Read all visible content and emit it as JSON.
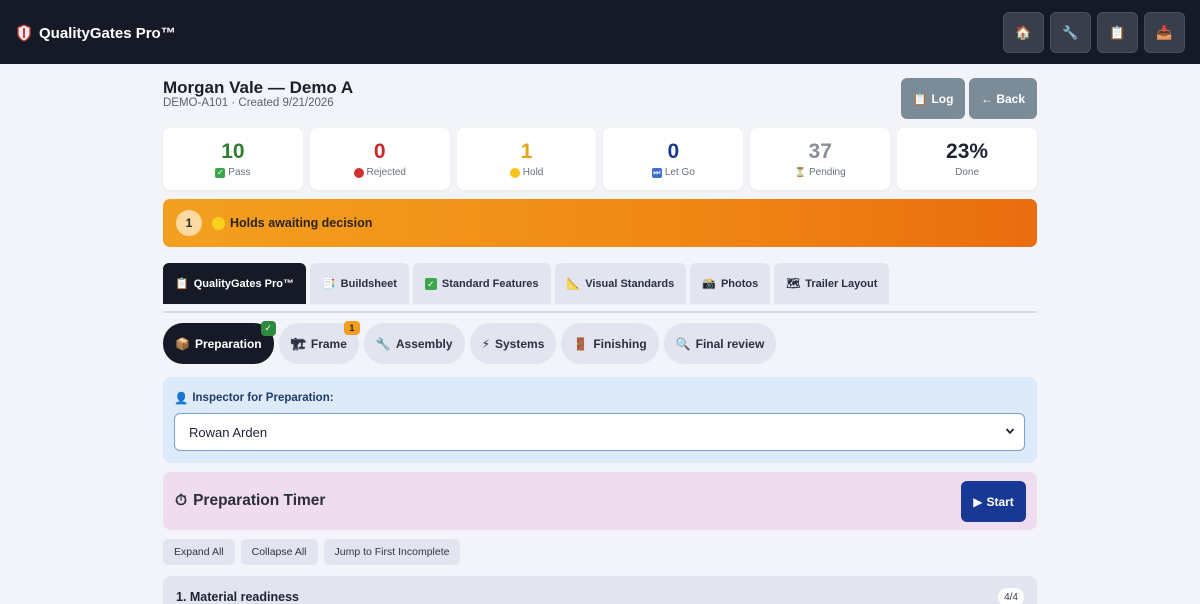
{
  "app": {
    "brand": "QualityGates Pro™",
    "nav": [
      {
        "icon": "home-icon",
        "glyph": "🏠"
      },
      {
        "icon": "wrench-icon",
        "glyph": "🔧"
      },
      {
        "icon": "clipboard-icon",
        "glyph": "📋"
      },
      {
        "icon": "inbox-tray-icon",
        "glyph": "📥"
      }
    ]
  },
  "header": {
    "title": "Morgan Vale — Demo A",
    "subtitle": "DEMO-A101 · Created 9/21/2026",
    "log_label": "Log",
    "back_label": "← Back"
  },
  "stats": [
    {
      "value": "10",
      "label": "Pass",
      "color": "#2e7d32"
    },
    {
      "value": "0",
      "label": "Rejected",
      "color": "#c62828"
    },
    {
      "value": "1",
      "label": "Hold",
      "color": "#e3a21a"
    },
    {
      "value": "0",
      "label": "Let Go",
      "color": "#1a3a8a"
    },
    {
      "value": "37",
      "label": "Pending",
      "color": "#8a8e98"
    },
    {
      "value": "23%",
      "label": "Done",
      "color": "#1d2333"
    }
  ],
  "holds": {
    "count": "1",
    "text": "Holds awaiting decision"
  },
  "tabs": [
    {
      "label": "QualityGates Pro™",
      "active": true
    },
    {
      "label": "Buildsheet"
    },
    {
      "label": "Standard Features"
    },
    {
      "label": "Visual Standards"
    },
    {
      "label": "Photos"
    },
    {
      "label": "Trailer Layout"
    }
  ],
  "stages": [
    {
      "label": "Preparation",
      "active": true,
      "badge": "✓"
    },
    {
      "label": "Frame",
      "badge": "1"
    },
    {
      "label": "Assembly"
    },
    {
      "label": "Systems"
    },
    {
      "label": "Finishing"
    },
    {
      "label": "Final review"
    }
  ],
  "inspector": {
    "label": "Inspector for Preparation:",
    "selected": "Rowan Arden"
  },
  "timer": {
    "title": "Preparation Timer",
    "start_label": "Start"
  },
  "actions": {
    "expand_all": "Expand All",
    "collapse_all": "Collapse All",
    "jump_first_incomplete": "Jump to First Incomplete"
  },
  "section": {
    "title": "1. Material readiness",
    "count": "4/4"
  }
}
